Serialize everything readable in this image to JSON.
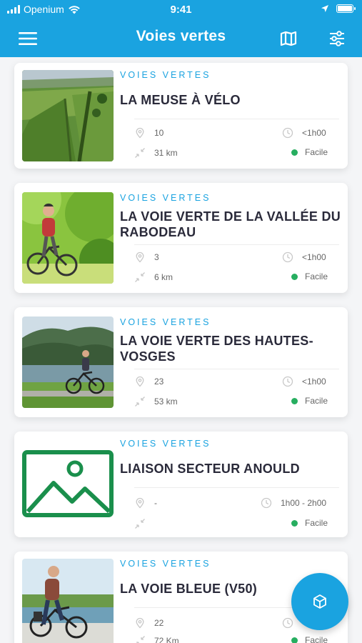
{
  "status_bar": {
    "carrier": "Openium",
    "time": "9:41"
  },
  "app_bar": {
    "title": "Voies vertes"
  },
  "cards": [
    {
      "category": "VOIES VERTES",
      "title": "LA MEUSE À VÉLO",
      "points": "10",
      "duration": "<1h00",
      "distance": "31 km",
      "difficulty": "Facile"
    },
    {
      "category": "VOIES VERTES",
      "title": "LA VOIE VERTE DE LA VALLÉE DU RABODEAU",
      "points": "3",
      "duration": "<1h00",
      "distance": "6 km",
      "difficulty": "Facile"
    },
    {
      "category": "VOIES VERTES",
      "title": "LA VOIE VERTE DES HAUTES-VOSGES",
      "points": "23",
      "duration": "<1h00",
      "distance": "53 km",
      "difficulty": "Facile"
    },
    {
      "category": "VOIES VERTES",
      "title": "LIAISON SECTEUR ANOULD",
      "points": "-",
      "duration": "1h00 - 2h00",
      "distance": "",
      "difficulty": "Facile"
    },
    {
      "category": "VOIES VERTES",
      "title": "LA VOIE BLEUE (V50)",
      "points": "22",
      "duration": "",
      "distance": "72 Km",
      "difficulty": "Facile"
    }
  ],
  "colors": {
    "primary": "#1aa3e0",
    "difficulty_easy": "#27ae60",
    "placeholder_green": "#1a8f4c"
  }
}
